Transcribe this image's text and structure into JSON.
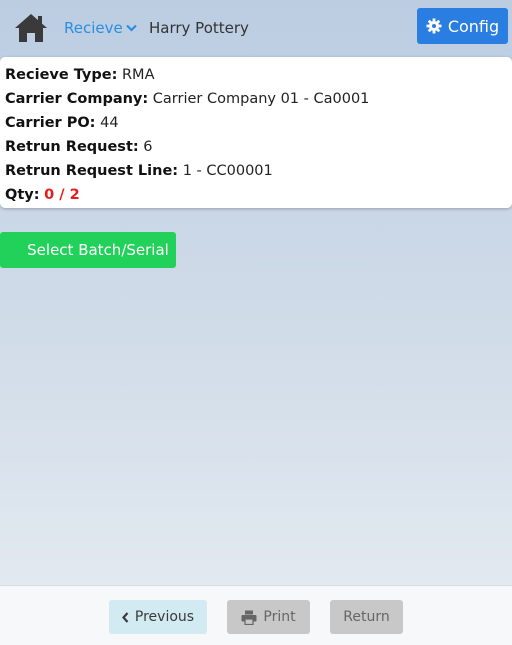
{
  "header": {
    "nav_menu_label": "Recieve",
    "user_name": "Harry Pottery",
    "config_label": "Config"
  },
  "info": {
    "receive_type": {
      "label": "Recieve Type:",
      "value": "RMA"
    },
    "carrier_company": {
      "label": "Carrier Company:",
      "value": "Carrier Company 01 - Ca0001"
    },
    "carrier_po": {
      "label": "Carrier PO:",
      "value": "44"
    },
    "return_request": {
      "label": "Retrun Request:",
      "value": "6"
    },
    "return_request_line": {
      "label": "Retrun Request Line:",
      "value": "1 - CC00001"
    },
    "qty": {
      "label": "Qty:",
      "value": "0 / 2"
    }
  },
  "actions": {
    "select_batch_label": "Select Batch/Serial"
  },
  "footer": {
    "previous_label": "Previous",
    "print_label": "Print",
    "return_label": "Return"
  },
  "colors": {
    "primary": "#2a7de1",
    "success": "#22d15a",
    "danger": "#e81c1c",
    "link": "#2a8ee0"
  },
  "icons": {
    "home": "home-icon",
    "nav_dropdown": "chevron-down-icon",
    "config": "gear-icon",
    "previous": "chevron-left-icon",
    "print": "printer-icon"
  }
}
